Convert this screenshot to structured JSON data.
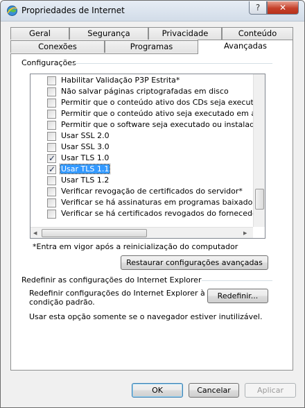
{
  "window": {
    "title": "Propriedades de Internet",
    "help_label": "?",
    "close_label": "✕"
  },
  "tabs_row1": [
    "Geral",
    "Segurança",
    "Privacidade",
    "Conteúdo"
  ],
  "tabs_row2": [
    "Conexões",
    "Programas",
    "Avançadas"
  ],
  "active_tab": "Avançadas",
  "settings": {
    "group_label": "Configurações",
    "items": [
      {
        "label": "Habilitar Validação P3P Estrita*",
        "checked": false
      },
      {
        "label": "Não salvar páginas criptografadas em disco",
        "checked": false
      },
      {
        "label": "Permitir que o conteúdo ativo dos CDs seja executado no",
        "checked": false
      },
      {
        "label": "Permitir que o conteúdo ativo seja executado em arquivos",
        "checked": false
      },
      {
        "label": "Permitir que o software seja executado ou instalado mesm",
        "checked": false
      },
      {
        "label": "Usar SSL 2.0",
        "checked": false
      },
      {
        "label": "Usar SSL 3.0",
        "checked": false
      },
      {
        "label": "Usar TLS 1.0",
        "checked": true
      },
      {
        "label": "Usar TLS 1.1",
        "checked": true,
        "selected": true
      },
      {
        "label": "Usar TLS 1.2",
        "checked": false
      },
      {
        "label": "Verificar revogação de certificados do servidor*",
        "checked": false
      },
      {
        "label": "Verificar se há assinaturas em programas baixados",
        "checked": false
      },
      {
        "label": "Verificar se há certificados revogados do fornecedor",
        "checked": false
      }
    ],
    "restart_note": "*Entra em vigor após a reinicialização do computador",
    "restore_button": "Restaurar configurações avançadas"
  },
  "reset": {
    "group_label": "Redefinir as configurações do Internet Explorer",
    "description_line1": "Redefinir configurações do Internet Explorer à",
    "description_line2": "condição padrão.",
    "button": "Redefinir...",
    "note": "Usar esta opção somente se o navegador estiver inutilizável."
  },
  "footer": {
    "ok": "OK",
    "cancel": "Cancelar",
    "apply": "Aplicar"
  },
  "colors": {
    "selection": "#3399ff",
    "close_button": "#c5402a",
    "default_button_border": "#3c7fb1"
  }
}
